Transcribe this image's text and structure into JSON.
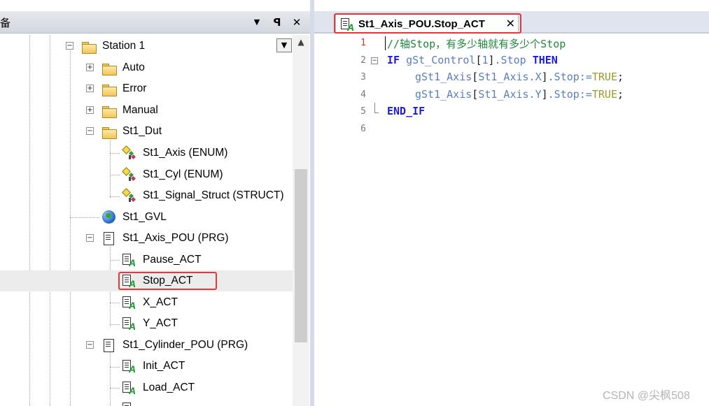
{
  "left_panel": {
    "title": "备",
    "header_buttons": {
      "dropdown": "▼",
      "pin": "ꟼ",
      "close": "✕"
    },
    "tree_dropdown": "▼",
    "scroll_up": "▲",
    "tree": {
      "station": "Station 1",
      "auto": "Auto",
      "error": "Error",
      "manual": "Manual",
      "dut": "St1_Dut",
      "axis_enum": "St1_Axis (ENUM)",
      "cyl_enum": "St1_Cyl (ENUM)",
      "signal_struct": "St1_Signal_Struct (STRUCT)",
      "gvl": "St1_GVL",
      "axis_pou": "St1_Axis_POU (PRG)",
      "pause_act": "Pause_ACT",
      "stop_act": "Stop_ACT",
      "x_act": "X_ACT",
      "y_act": "Y_ACT",
      "cylinder_pou": "St1_Cylinder_POU (PRG)",
      "init_act": "Init_ACT",
      "load_act": "Load_ACT"
    },
    "expanders": {
      "collapsed": "+",
      "expanded": "−"
    }
  },
  "editor": {
    "tab_label": "St1_Axis_POU.Stop_ACT",
    "tab_close": "✕",
    "line_numbers": [
      "1",
      "2",
      "3",
      "4",
      "5",
      "6"
    ],
    "fold_button": "−",
    "code": {
      "l1_comment": "//轴Stop，有多少轴就有多少个Stop",
      "l2_if": "IF",
      "l2_var": "gSt_Control",
      "l2_open": "[",
      "l2_idx": "1",
      "l2_close": "]",
      "l2_member": ".Stop",
      "l2_then": "THEN",
      "l3_var": "gSt1_Axis",
      "l3_open": "[",
      "l3_idx": "St1_Axis.X",
      "l3_close": "]",
      "l3_member": ".Stop:=",
      "l3_val": "TRUE",
      "l3_end": ";",
      "l4_var": "gSt1_Axis",
      "l4_open": "[",
      "l4_idx": "St1_Axis.Y",
      "l4_close": "]",
      "l4_member": ".Stop:=",
      "l4_val": "TRUE",
      "l4_end": ";",
      "l5_end": "END_IF"
    }
  },
  "watermark": "CSDN @尖枫508",
  "colors": {
    "highlight_red": "#e23a3a",
    "keyword": "#1a1adc",
    "comment": "#1c8a3a",
    "literal": "#9a9a2a",
    "action_icon_green": "#1a9a2a"
  }
}
